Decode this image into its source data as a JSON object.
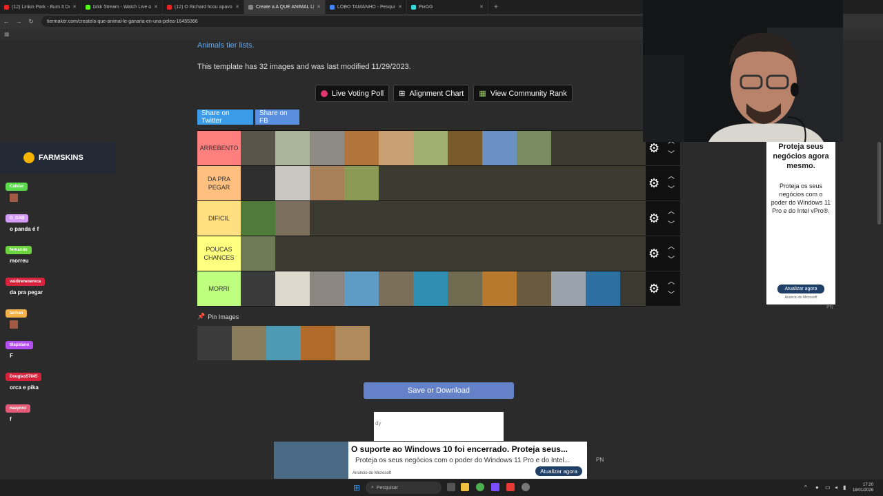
{
  "tabs": [
    {
      "label": "(12) Linkin Park - Burn It Down",
      "color": "#e22"
    },
    {
      "label": "brkk Stream - Watch Live on K",
      "color": "#53fc18"
    },
    {
      "label": "(12) O Richard ficou apavorad",
      "color": "#e22"
    },
    {
      "label": "Create a A QUE ANIMAL LE GA",
      "color": "#888",
      "active": true
    },
    {
      "label": "LOBO TAMANHO - Pesquisa Go",
      "color": "#4285f4"
    },
    {
      "label": "PixGG",
      "color": "#3dd"
    }
  ],
  "url": "tiermaker.com/create/a-que-animal-le-ganaria-en-una-pelea-16455366",
  "page": {
    "category_link": "Animals tier lists.",
    "template_info": "This template has 32 images and was last modified 11/29/2023.",
    "buttons": {
      "voting": "Live Voting Poll",
      "alignment": "Alignment Chart",
      "community": "View Community Rank"
    },
    "share_twitter": "Share on Twitter",
    "share_fb": "Share on FB",
    "pin_label": "Pin Images",
    "save_label": "Save or Download",
    "ad_small_text": "dy"
  },
  "tiers": [
    {
      "label": "ARREBENTO",
      "color": "#ff7f7f",
      "items": [
        "tortoise",
        "goat",
        "koala",
        "rooster",
        "guinea-pig",
        "squirrel",
        "scorpion",
        "penguin",
        "otter"
      ]
    },
    {
      "label": "DA PRA PEGAR",
      "color": "#ffbf7f",
      "items": [
        "cow",
        "sheep",
        "kangaroo",
        "capybara"
      ]
    },
    {
      "label": "DIFICIL",
      "color": "#ffdf7f",
      "items": [
        "snake",
        "donkey"
      ]
    },
    {
      "label": "POUCAS CHANCES",
      "color": "#ffff7f",
      "items": [
        "crocodile"
      ]
    },
    {
      "label": "MORRI",
      "color": "#bfff7f",
      "items": [
        "gorilla",
        "eagle",
        "wolf",
        "dolphin",
        "hippo",
        "shark",
        "boar",
        "lion",
        "moose",
        "rhino",
        "orca"
      ]
    }
  ],
  "pinned": [
    "panda",
    "piranha",
    "octopus",
    "tiger",
    "lynx"
  ],
  "item_colors": {
    "tortoise": "#5a5548",
    "goat": "#a9b59a",
    "koala": "#8e8a84",
    "rooster": "#b1743a",
    "guinea-pig": "#c8a074",
    "squirrel": "#9fb071",
    "scorpion": "#7a5a2a",
    "penguin": "#6b90c3",
    "otter": "#7b8b62",
    "cow": "#2f2f2f",
    "sheep": "#c9c7c2",
    "kangaroo": "#a8805a",
    "capybara": "#8a9a55",
    "snake": "#4e7a3a",
    "donkey": "#7d6f5e",
    "crocodile": "#6e7a55",
    "gorilla": "#3a3a3a",
    "eagle": "#ded9cc",
    "wolf": "#8b8780",
    "dolphin": "#5e9bc5",
    "hippo": "#7a6e58",
    "shark": "#2e8fb3",
    "boar": "#6f6a50",
    "lion": "#b8782e",
    "moose": "#6a5a40",
    "rhino": "#9aa3ab",
    "orca": "#2d6fa0",
    "panda": "#3b3b3b",
    "piranha": "#8a7d5e",
    "octopus": "#4e9ab5",
    "tiger": "#b06a2a",
    "lynx": "#b08a5a"
  },
  "side_ad": {
    "headline": "Proteja seus negócios agora mesmo.",
    "body": "Proteja os seus negócios com o poder do Windows 11 Pro e do Intel vPro®.",
    "button": "Atualizar agora",
    "meta": "Anúncio do Microsoft"
  },
  "bottom_ad": {
    "headline": "O suporte ao Windows 10 foi encerrado. Proteja seus...",
    "body": "Proteja os seus negócios com o poder do Windows 11 Pro e do Intel...",
    "meta": "Anúncio do Microsoft",
    "button": "Atualizar agora"
  },
  "pn": "PN",
  "overlay": {
    "brand": "FARMSKINS",
    "chat": [
      {
        "name": "Callder",
        "color": "#5cd94c",
        "msg": ""
      },
      {
        "name": "G_GAB",
        "color": "#d59cf7",
        "msg": "o panda é f"
      },
      {
        "name": "fernando",
        "color": "#6bd43f",
        "msg": "morreu"
      },
      {
        "name": "valdirenexereca",
        "color": "#d6243f",
        "msg": "da pra pegar"
      },
      {
        "name": "lanhan",
        "color": "#f2b04a",
        "msg": ""
      },
      {
        "name": "tilapidano",
        "color": "#b24df0",
        "msg": "F"
      },
      {
        "name": "Douglas57845",
        "color": "#d8223c",
        "msg": "orca e pika"
      },
      {
        "name": "naayonz",
        "color": "#e35c77",
        "msg": "f"
      }
    ]
  },
  "taskbar": {
    "search": "Pesquisar",
    "time": "17:20",
    "date": "18/01/2026"
  }
}
